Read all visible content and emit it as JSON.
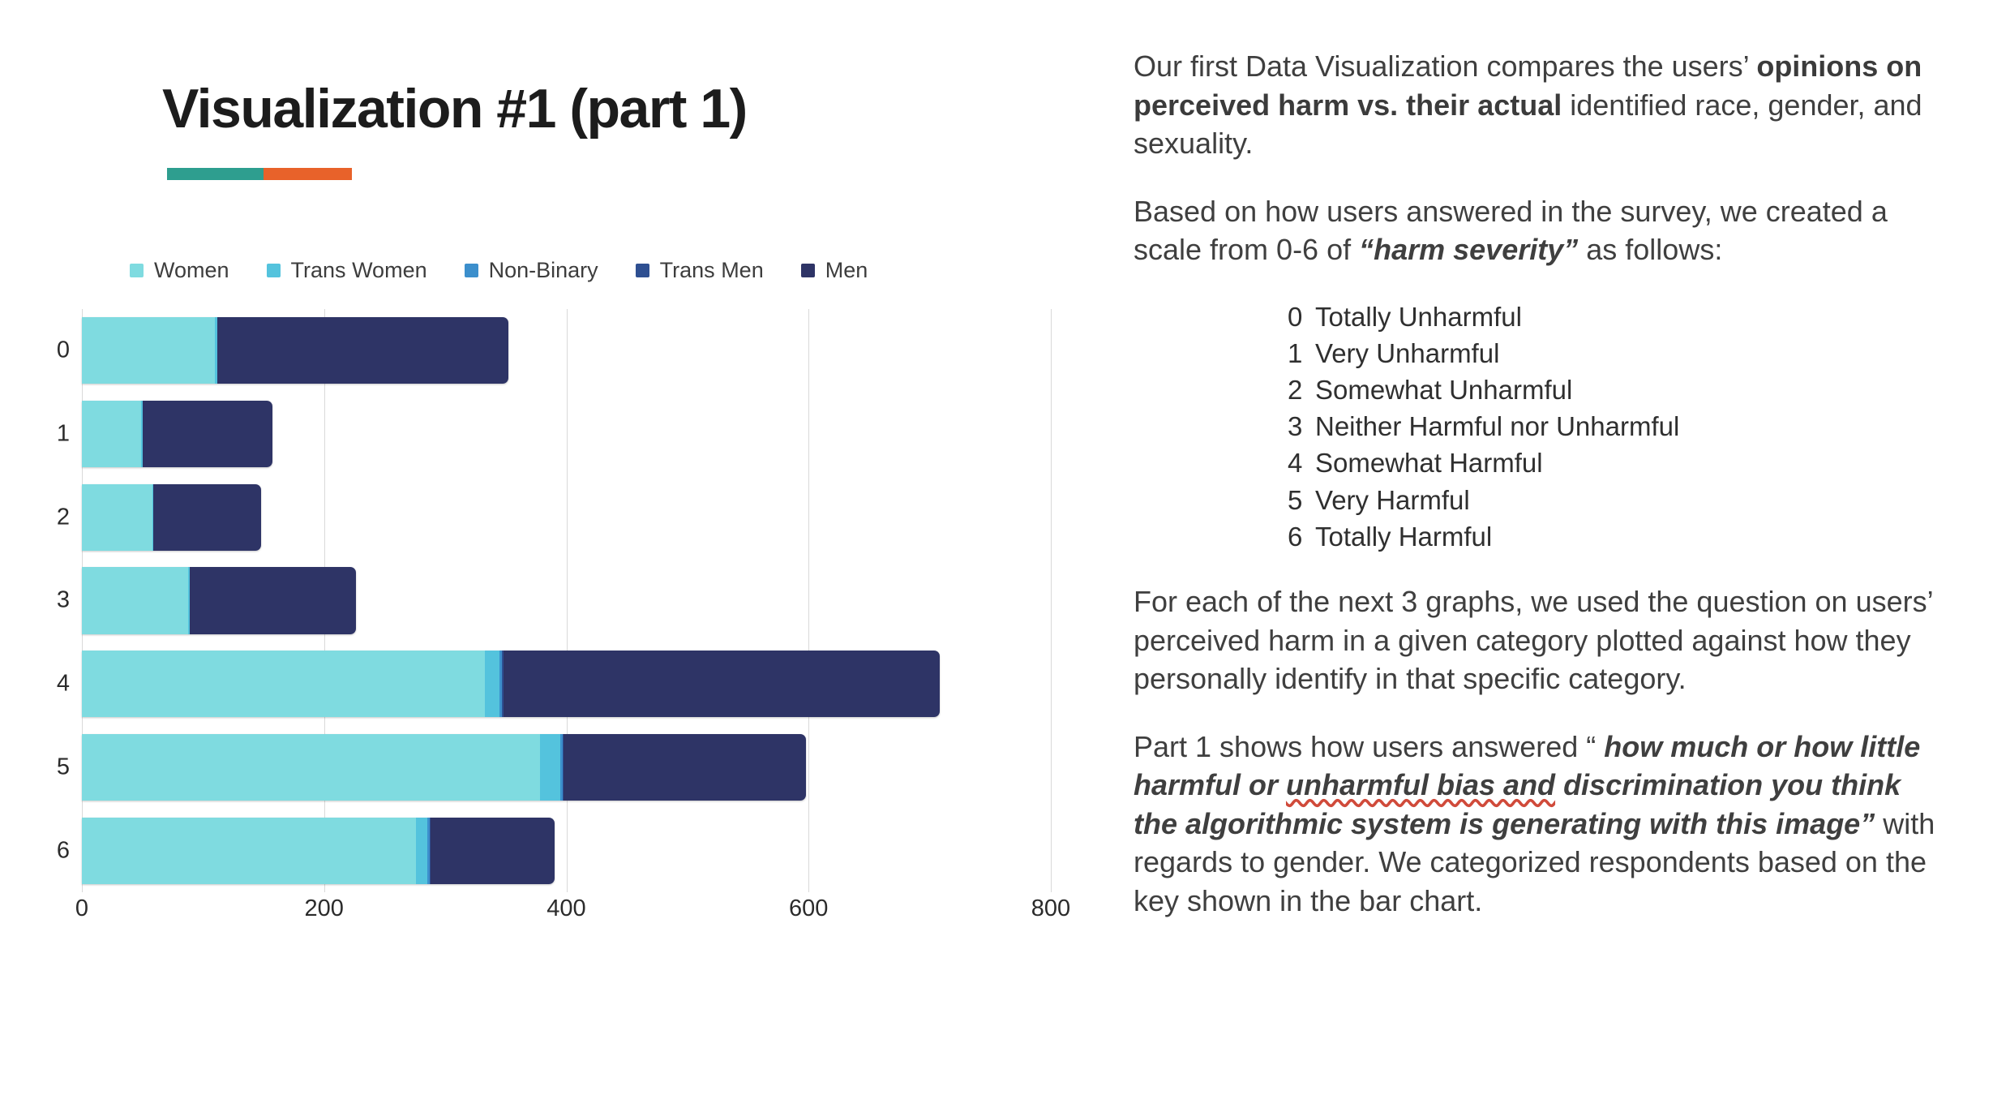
{
  "slide": {
    "title": "Visualization #1 (part 1)",
    "accent_colors": {
      "rule_left": "#2e9e8f",
      "rule_right": "#e8622a"
    }
  },
  "chart_data": {
    "type": "bar",
    "orientation": "horizontal",
    "stacked": true,
    "title": "",
    "xlabel": "",
    "ylabel": "",
    "xlim": [
      0,
      800
    ],
    "xticks": [
      0,
      200,
      400,
      600,
      800
    ],
    "categories": [
      "0",
      "1",
      "2",
      "3",
      "4",
      "5",
      "6"
    ],
    "grid": "vertical",
    "legend_position": "top-left",
    "series": [
      {
        "name": "Women",
        "color": "#7fdbe0",
        "values": [
          110,
          49,
          58,
          88,
          333,
          378,
          276
        ]
      },
      {
        "name": "Trans Women",
        "color": "#54c3dd",
        "values": [
          2,
          1,
          1,
          1,
          12,
          17,
          9
        ]
      },
      {
        "name": "Non-Binary",
        "color": "#3c8fcc",
        "values": [
          0,
          0,
          0,
          0,
          2,
          2,
          2
        ]
      },
      {
        "name": "Trans Men",
        "color": "#2e4f91",
        "values": [
          0,
          0,
          0,
          0,
          1,
          1,
          1
        ]
      },
      {
        "name": "Men",
        "color": "#2e3466",
        "values": [
          240,
          107,
          89,
          137,
          360,
          200,
          102
        ]
      }
    ]
  },
  "text": {
    "p1_a": "Our first Data Visualization compares the users’ ",
    "p1_b": "opinions on perceived harm vs. their actual",
    "p1_c": " identified race, gender, and sexuality.",
    "p2_a": "Based on how users answered in the survey, we created a scale from 0-6 of ",
    "p2_b": "“harm severity”",
    "p2_c": " as follows:",
    "scale": [
      {
        "num": "0",
        "label": "Totally Unharmful"
      },
      {
        "num": "1",
        "label": "Very Unharmful"
      },
      {
        "num": "2",
        "label": "Somewhat Unharmful"
      },
      {
        "num": "3",
        "label": "Neither Harmful nor Unharmful"
      },
      {
        "num": "4",
        "label": "Somewhat Harmful"
      },
      {
        "num": "5",
        "label": "Very Harmful"
      },
      {
        "num": "6",
        "label": "Totally Harmful"
      }
    ],
    "p3": "For each of the next 3 graphs, we used the question on users’ perceived harm in a given category plotted against how they personally identify in that specific category.",
    "p4_a": "Part 1 shows how users answered “ ",
    "p4_quote_1": "how much or how little harmful or ",
    "p4_quote_squiggle": "unharmful bias and",
    "p4_quote_2": " discrimination you think the algorithmic system is generating with this image”",
    "p4_b": " with regards to gender. We categorized respondents based on the key shown in the bar chart."
  }
}
